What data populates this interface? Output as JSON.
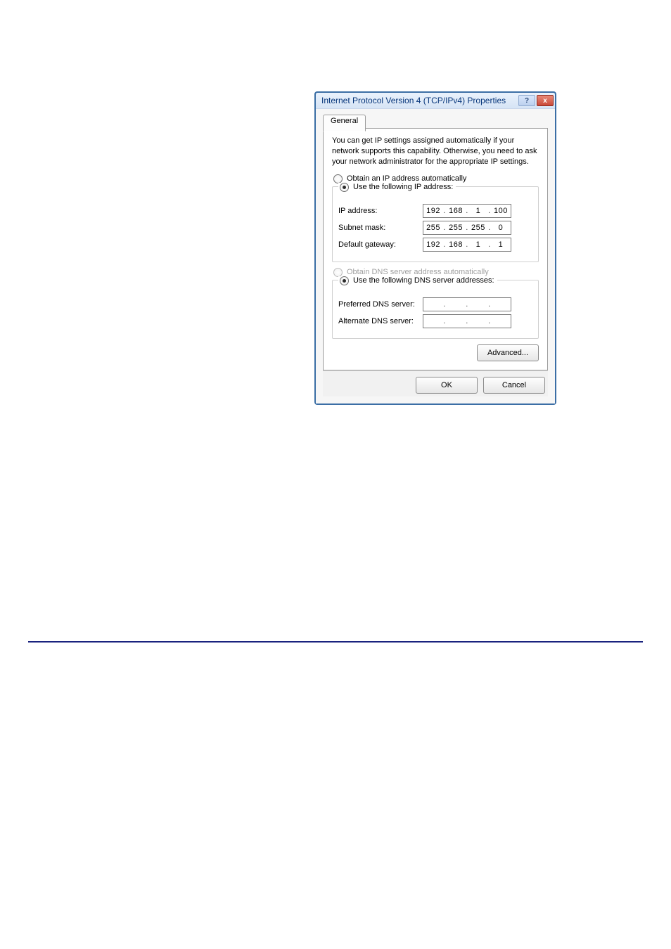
{
  "dialog": {
    "title": "Internet Protocol Version 4 (TCP/IPv4) Properties",
    "help_symbol": "?",
    "close_symbol": "x",
    "tab_general": "General",
    "description": "You can get IP settings assigned automatically if your network supports this capability. Otherwise, you need to ask your network administrator for the appropriate IP settings.",
    "ip": {
      "radio_auto": "Obtain an IP address automatically",
      "radio_auto_ul": "O",
      "radio_manual": "Use the following IP address:",
      "radio_manual_ul": "S",
      "label_ip": "IP address:",
      "label_ip_ul": "I",
      "label_subnet": "Subnet mask:",
      "label_subnet_ul": "u",
      "label_gateway": "Default gateway:",
      "label_gateway_ul": "D",
      "ip_octets": [
        "192",
        "168",
        "1",
        "100"
      ],
      "subnet_octets": [
        "255",
        "255",
        "255",
        "0"
      ],
      "gateway_octets": [
        "192",
        "168",
        "1",
        "1"
      ]
    },
    "dns": {
      "radio_auto": "Obtain DNS server address automatically",
      "radio_auto_ul": "b",
      "radio_manual": "Use the following DNS server addresses:",
      "radio_manual_ul": "e",
      "label_preferred": "Preferred DNS server:",
      "label_preferred_ul": "P",
      "label_alternate": "Alternate DNS server:",
      "label_alternate_ul": "A",
      "preferred_octets": [
        "",
        "",
        "",
        ""
      ],
      "alternate_octets": [
        "",
        "",
        "",
        ""
      ]
    },
    "btn_advanced": "Advanced...",
    "btn_advanced_ul": "V",
    "btn_ok": "OK",
    "btn_cancel": "Cancel"
  }
}
